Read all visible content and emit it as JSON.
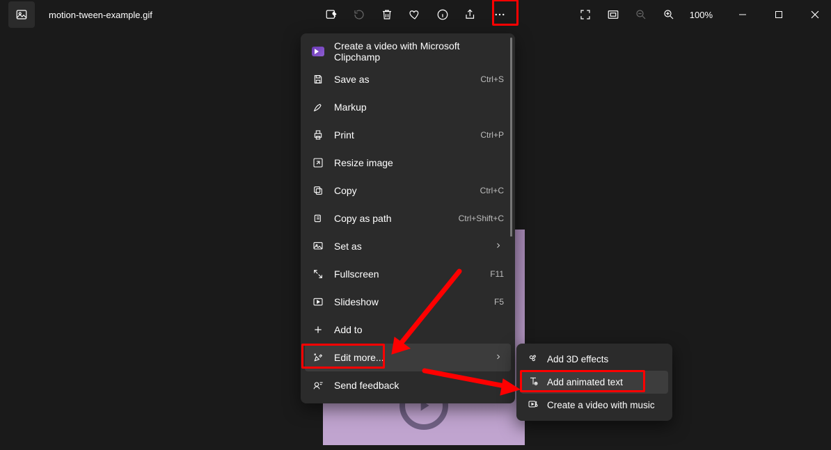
{
  "filename": "motion-tween-example.gif",
  "zoom": "100%",
  "menu": {
    "clipchamp": "Create a video with Microsoft Clipchamp",
    "saveas": {
      "label": "Save as",
      "shortcut": "Ctrl+S"
    },
    "markup": "Markup",
    "print": {
      "label": "Print",
      "shortcut": "Ctrl+P"
    },
    "resize": "Resize image",
    "copy": {
      "label": "Copy",
      "shortcut": "Ctrl+C"
    },
    "copypath": {
      "label": "Copy as path",
      "shortcut": "Ctrl+Shift+C"
    },
    "setas": "Set as",
    "fullscreen": {
      "label": "Fullscreen",
      "shortcut": "F11"
    },
    "slideshow": {
      "label": "Slideshow",
      "shortcut": "F5"
    },
    "addto": "Add to",
    "editmore": "Edit more...",
    "feedback": "Send feedback"
  },
  "submenu": {
    "3d": "Add 3D effects",
    "anim": "Add animated text",
    "vidmusic": "Create a video with music"
  }
}
